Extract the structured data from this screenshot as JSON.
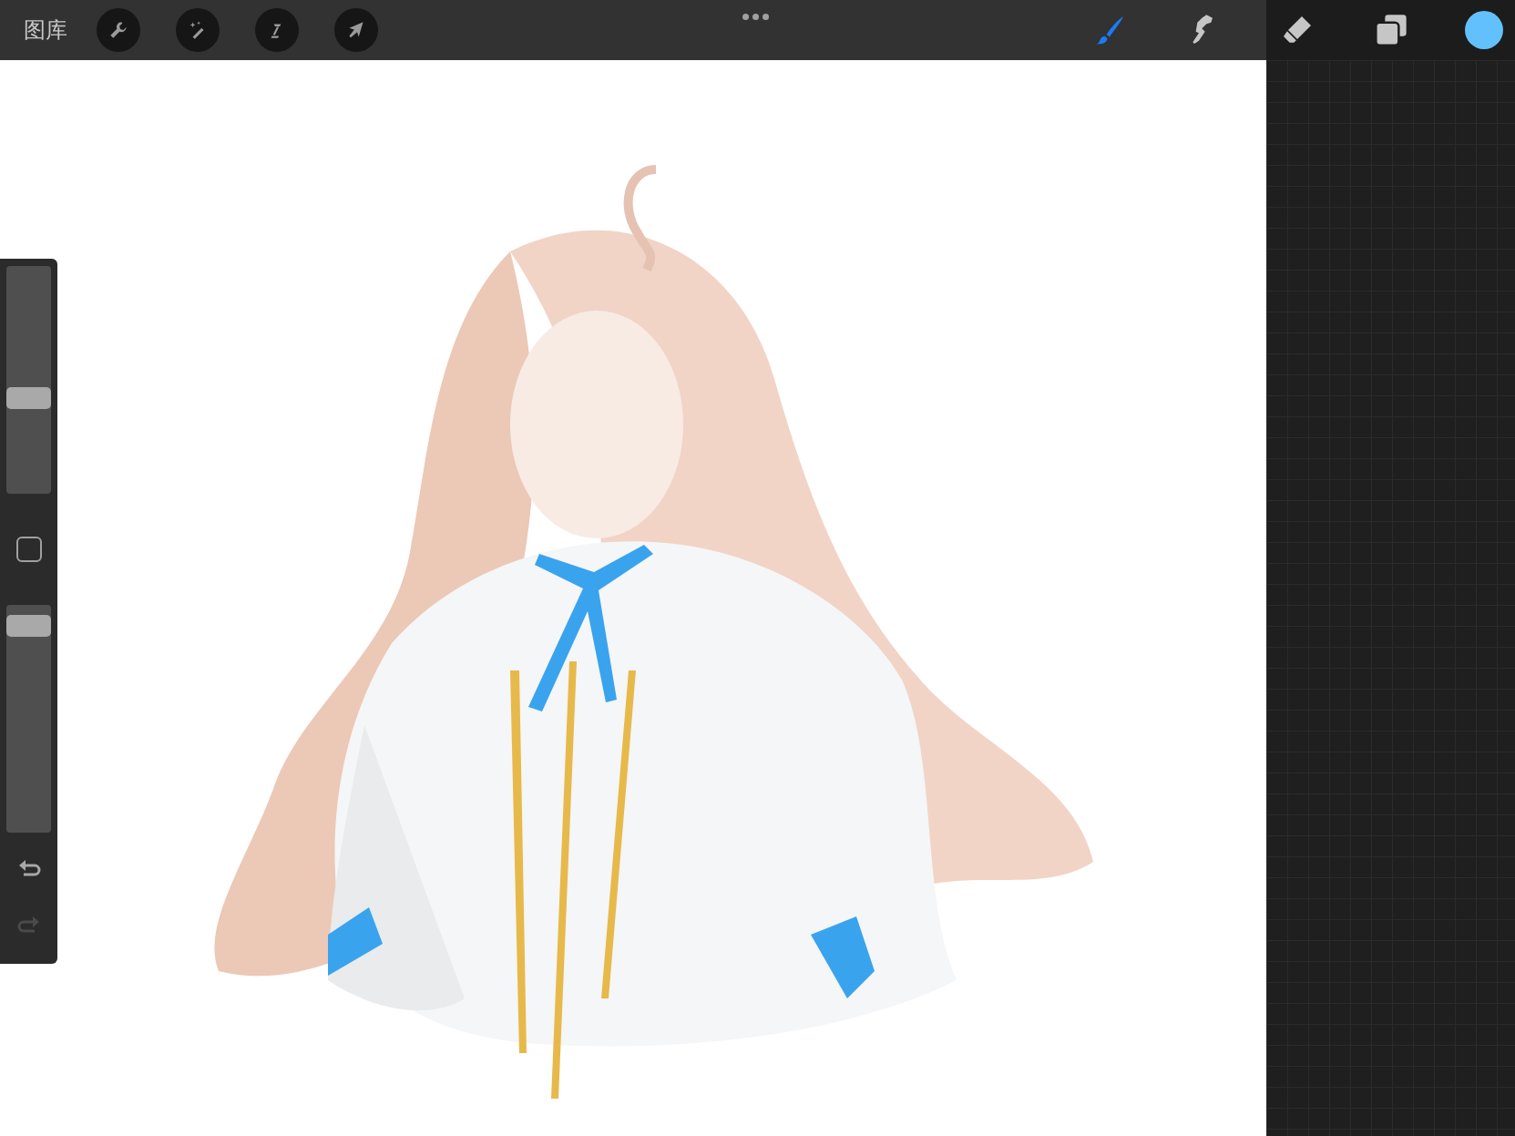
{
  "toolbar": {
    "gallery_label": "图库",
    "left_tools": [
      {
        "kind": "wrench"
      },
      {
        "kind": "wand"
      },
      {
        "kind": "selection"
      },
      {
        "kind": "move"
      }
    ],
    "right_tools": [
      {
        "kind": "brush",
        "selected": true
      },
      {
        "kind": "smudge",
        "selected": false
      },
      {
        "kind": "eraser",
        "selected": false
      },
      {
        "kind": "layers",
        "selected": false
      }
    ]
  },
  "sidebar": {
    "sliders": [
      {
        "level": 0.41
      },
      {
        "level": 0.95
      }
    ],
    "undo": {
      "disabled": false
    },
    "redo": {
      "disabled": true
    }
  }
}
